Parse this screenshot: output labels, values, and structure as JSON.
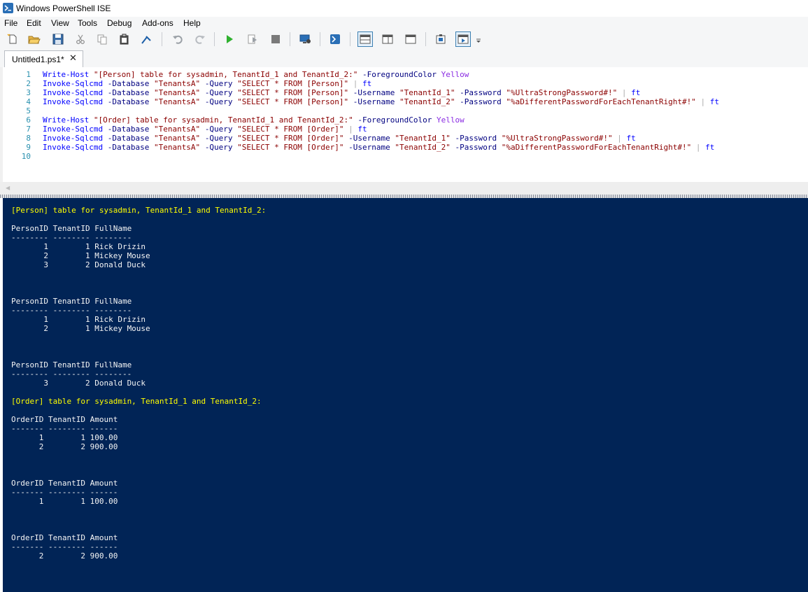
{
  "window": {
    "title": "Windows PowerShell ISE",
    "icon": "powershell-icon"
  },
  "menu": [
    {
      "label": "File"
    },
    {
      "label": "Edit"
    },
    {
      "label": "View"
    },
    {
      "label": "Tools"
    },
    {
      "label": "Debug"
    },
    {
      "label": "Add-ons"
    },
    {
      "label": "Help"
    }
  ],
  "toolbar": {
    "buttons": [
      {
        "name": "new-icon"
      },
      {
        "name": "open-icon"
      },
      {
        "name": "save-icon"
      },
      {
        "name": "cut-icon"
      },
      {
        "name": "copy-icon"
      },
      {
        "name": "paste-icon"
      },
      {
        "name": "clear-console-icon"
      },
      {
        "name": "undo-icon"
      },
      {
        "name": "redo-icon"
      },
      {
        "name": "run-script-icon"
      },
      {
        "name": "run-selection-icon"
      },
      {
        "name": "stop-icon"
      },
      {
        "name": "remote-powershell-icon"
      },
      {
        "name": "powershell-icon"
      },
      {
        "name": "layout-top-icon"
      },
      {
        "name": "layout-right-icon"
      },
      {
        "name": "layout-max-icon"
      },
      {
        "name": "show-commands-icon"
      },
      {
        "name": "show-addon-icon"
      },
      {
        "name": "overflow-icon"
      }
    ]
  },
  "tabs": [
    {
      "label": "Untitled1.ps1*",
      "close": "✕"
    }
  ],
  "editor": {
    "lines": [
      {
        "n": "1",
        "tokens": [
          {
            "t": "Write-Host",
            "c": "c-cmd"
          },
          {
            "t": " ",
            "c": "c-plain"
          },
          {
            "t": "\"[Person] table for sysadmin, TenantId_1 and TenantId_2:\"",
            "c": "c-str"
          },
          {
            "t": " ",
            "c": "c-plain"
          },
          {
            "t": "-ForegroundColor",
            "c": "c-par"
          },
          {
            "t": " ",
            "c": "c-plain"
          },
          {
            "t": "Yellow",
            "c": "c-kw"
          }
        ]
      },
      {
        "n": "2",
        "tokens": [
          {
            "t": "Invoke-Sqlcmd",
            "c": "c-cmd"
          },
          {
            "t": " ",
            "c": "c-plain"
          },
          {
            "t": "-Database",
            "c": "c-par"
          },
          {
            "t": " ",
            "c": "c-plain"
          },
          {
            "t": "\"TenantsA\"",
            "c": "c-str"
          },
          {
            "t": " ",
            "c": "c-plain"
          },
          {
            "t": "-Query",
            "c": "c-par"
          },
          {
            "t": " ",
            "c": "c-plain"
          },
          {
            "t": "\"SELECT * FROM [Person]\"",
            "c": "c-str"
          },
          {
            "t": " ",
            "c": "c-plain"
          },
          {
            "t": "|",
            "c": "c-op"
          },
          {
            "t": " ",
            "c": "c-plain"
          },
          {
            "t": "ft",
            "c": "c-cmd"
          }
        ]
      },
      {
        "n": "3",
        "tokens": [
          {
            "t": "Invoke-Sqlcmd",
            "c": "c-cmd"
          },
          {
            "t": " ",
            "c": "c-plain"
          },
          {
            "t": "-Database",
            "c": "c-par"
          },
          {
            "t": " ",
            "c": "c-plain"
          },
          {
            "t": "\"TenantsA\"",
            "c": "c-str"
          },
          {
            "t": " ",
            "c": "c-plain"
          },
          {
            "t": "-Query",
            "c": "c-par"
          },
          {
            "t": " ",
            "c": "c-plain"
          },
          {
            "t": "\"SELECT * FROM [Person]\"",
            "c": "c-str"
          },
          {
            "t": " ",
            "c": "c-plain"
          },
          {
            "t": "-Username",
            "c": "c-par"
          },
          {
            "t": " ",
            "c": "c-plain"
          },
          {
            "t": "\"TenantId_1\"",
            "c": "c-str"
          },
          {
            "t": " ",
            "c": "c-plain"
          },
          {
            "t": "-Password",
            "c": "c-par"
          },
          {
            "t": " ",
            "c": "c-plain"
          },
          {
            "t": "\"%UltraStrongPassword#!\"",
            "c": "c-str"
          },
          {
            "t": " ",
            "c": "c-plain"
          },
          {
            "t": "|",
            "c": "c-op"
          },
          {
            "t": " ",
            "c": "c-plain"
          },
          {
            "t": "ft",
            "c": "c-cmd"
          }
        ]
      },
      {
        "n": "4",
        "tokens": [
          {
            "t": "Invoke-Sqlcmd",
            "c": "c-cmd"
          },
          {
            "t": " ",
            "c": "c-plain"
          },
          {
            "t": "-Database",
            "c": "c-par"
          },
          {
            "t": " ",
            "c": "c-plain"
          },
          {
            "t": "\"TenantsA\"",
            "c": "c-str"
          },
          {
            "t": " ",
            "c": "c-plain"
          },
          {
            "t": "-Query",
            "c": "c-par"
          },
          {
            "t": " ",
            "c": "c-plain"
          },
          {
            "t": "\"SELECT * FROM [Person]\"",
            "c": "c-str"
          },
          {
            "t": " ",
            "c": "c-plain"
          },
          {
            "t": "-Username",
            "c": "c-par"
          },
          {
            "t": " ",
            "c": "c-plain"
          },
          {
            "t": "\"TenantId_2\"",
            "c": "c-str"
          },
          {
            "t": " ",
            "c": "c-plain"
          },
          {
            "t": "-Password",
            "c": "c-par"
          },
          {
            "t": " ",
            "c": "c-plain"
          },
          {
            "t": "\"%aDifferentPasswordForEachTenantRight#!\"",
            "c": "c-str"
          },
          {
            "t": " ",
            "c": "c-plain"
          },
          {
            "t": "|",
            "c": "c-op"
          },
          {
            "t": " ",
            "c": "c-plain"
          },
          {
            "t": "ft",
            "c": "c-cmd"
          }
        ]
      },
      {
        "n": "5",
        "tokens": []
      },
      {
        "n": "6",
        "tokens": [
          {
            "t": "Write-Host",
            "c": "c-cmd"
          },
          {
            "t": " ",
            "c": "c-plain"
          },
          {
            "t": "\"[Order] table for sysadmin, TenantId_1 and TenantId_2:\"",
            "c": "c-str"
          },
          {
            "t": " ",
            "c": "c-plain"
          },
          {
            "t": "-ForegroundColor",
            "c": "c-par"
          },
          {
            "t": " ",
            "c": "c-plain"
          },
          {
            "t": "Yellow",
            "c": "c-kw"
          }
        ]
      },
      {
        "n": "7",
        "tokens": [
          {
            "t": "Invoke-Sqlcmd",
            "c": "c-cmd"
          },
          {
            "t": " ",
            "c": "c-plain"
          },
          {
            "t": "-Database",
            "c": "c-par"
          },
          {
            "t": " ",
            "c": "c-plain"
          },
          {
            "t": "\"TenantsA\"",
            "c": "c-str"
          },
          {
            "t": " ",
            "c": "c-plain"
          },
          {
            "t": "-Query",
            "c": "c-par"
          },
          {
            "t": " ",
            "c": "c-plain"
          },
          {
            "t": "\"SELECT * FROM [Order]\"",
            "c": "c-str"
          },
          {
            "t": " ",
            "c": "c-plain"
          },
          {
            "t": "|",
            "c": "c-op"
          },
          {
            "t": " ",
            "c": "c-plain"
          },
          {
            "t": "ft",
            "c": "c-cmd"
          }
        ]
      },
      {
        "n": "8",
        "tokens": [
          {
            "t": "Invoke-Sqlcmd",
            "c": "c-cmd"
          },
          {
            "t": " ",
            "c": "c-plain"
          },
          {
            "t": "-Database",
            "c": "c-par"
          },
          {
            "t": " ",
            "c": "c-plain"
          },
          {
            "t": "\"TenantsA\"",
            "c": "c-str"
          },
          {
            "t": " ",
            "c": "c-plain"
          },
          {
            "t": "-Query",
            "c": "c-par"
          },
          {
            "t": " ",
            "c": "c-plain"
          },
          {
            "t": "\"SELECT * FROM [Order]\"",
            "c": "c-str"
          },
          {
            "t": " ",
            "c": "c-plain"
          },
          {
            "t": "-Username",
            "c": "c-par"
          },
          {
            "t": " ",
            "c": "c-plain"
          },
          {
            "t": "\"TenantId_1\"",
            "c": "c-str"
          },
          {
            "t": " ",
            "c": "c-plain"
          },
          {
            "t": "-Password",
            "c": "c-par"
          },
          {
            "t": " ",
            "c": "c-plain"
          },
          {
            "t": "\"%UltraStrongPassword#!\"",
            "c": "c-str"
          },
          {
            "t": " ",
            "c": "c-plain"
          },
          {
            "t": "|",
            "c": "c-op"
          },
          {
            "t": " ",
            "c": "c-plain"
          },
          {
            "t": "ft",
            "c": "c-cmd"
          }
        ]
      },
      {
        "n": "9",
        "tokens": [
          {
            "t": "Invoke-Sqlcmd",
            "c": "c-cmd"
          },
          {
            "t": " ",
            "c": "c-plain"
          },
          {
            "t": "-Database",
            "c": "c-par"
          },
          {
            "t": " ",
            "c": "c-plain"
          },
          {
            "t": "\"TenantsA\"",
            "c": "c-str"
          },
          {
            "t": " ",
            "c": "c-plain"
          },
          {
            "t": "-Query",
            "c": "c-par"
          },
          {
            "t": " ",
            "c": "c-plain"
          },
          {
            "t": "\"SELECT * FROM [Order]\"",
            "c": "c-str"
          },
          {
            "t": " ",
            "c": "c-plain"
          },
          {
            "t": "-Username",
            "c": "c-par"
          },
          {
            "t": " ",
            "c": "c-plain"
          },
          {
            "t": "\"TenantId_2\"",
            "c": "c-str"
          },
          {
            "t": " ",
            "c": "c-plain"
          },
          {
            "t": "-Password",
            "c": "c-par"
          },
          {
            "t": " ",
            "c": "c-plain"
          },
          {
            "t": "\"%aDifferentPasswordForEachTenantRight#!\"",
            "c": "c-str"
          },
          {
            "t": " ",
            "c": "c-plain"
          },
          {
            "t": "|",
            "c": "c-op"
          },
          {
            "t": " ",
            "c": "c-plain"
          },
          {
            "t": "ft",
            "c": "c-cmd"
          }
        ]
      },
      {
        "n": "10",
        "tokens": []
      }
    ]
  },
  "console": {
    "lines": [
      {
        "text": "[Person] table for sysadmin, TenantId_1 and TenantId_2:",
        "color": "yellow"
      },
      {
        "text": ""
      },
      {
        "text": "PersonID TenantID FullName"
      },
      {
        "text": "-------- -------- --------"
      },
      {
        "text": "       1        1 Rick Drizin"
      },
      {
        "text": "       2        1 Mickey Mouse"
      },
      {
        "text": "       3        2 Donald Duck"
      },
      {
        "text": ""
      },
      {
        "text": ""
      },
      {
        "text": ""
      },
      {
        "text": "PersonID TenantID FullName"
      },
      {
        "text": "-------- -------- --------"
      },
      {
        "text": "       1        1 Rick Drizin"
      },
      {
        "text": "       2        1 Mickey Mouse"
      },
      {
        "text": ""
      },
      {
        "text": ""
      },
      {
        "text": ""
      },
      {
        "text": "PersonID TenantID FullName"
      },
      {
        "text": "-------- -------- --------"
      },
      {
        "text": "       3        2 Donald Duck"
      },
      {
        "text": ""
      },
      {
        "text": "[Order] table for sysadmin, TenantId_1 and TenantId_2:",
        "color": "yellow"
      },
      {
        "text": ""
      },
      {
        "text": "OrderID TenantID Amount"
      },
      {
        "text": "------- -------- ------"
      },
      {
        "text": "      1        1 100.00"
      },
      {
        "text": "      2        2 900.00"
      },
      {
        "text": ""
      },
      {
        "text": ""
      },
      {
        "text": ""
      },
      {
        "text": "OrderID TenantID Amount"
      },
      {
        "text": "------- -------- ------"
      },
      {
        "text": "      1        1 100.00"
      },
      {
        "text": ""
      },
      {
        "text": ""
      },
      {
        "text": ""
      },
      {
        "text": "OrderID TenantID Amount"
      },
      {
        "text": "------- -------- ------"
      },
      {
        "text": "      2        2 900.00"
      }
    ]
  },
  "colors": {
    "console_bg": "#012456",
    "console_fg": "#f5f5f5",
    "console_highlight": "#ffff00",
    "editor_cmdlet": "#0000ff",
    "editor_string": "#8b0000",
    "editor_keyword": "#8a2be2"
  }
}
